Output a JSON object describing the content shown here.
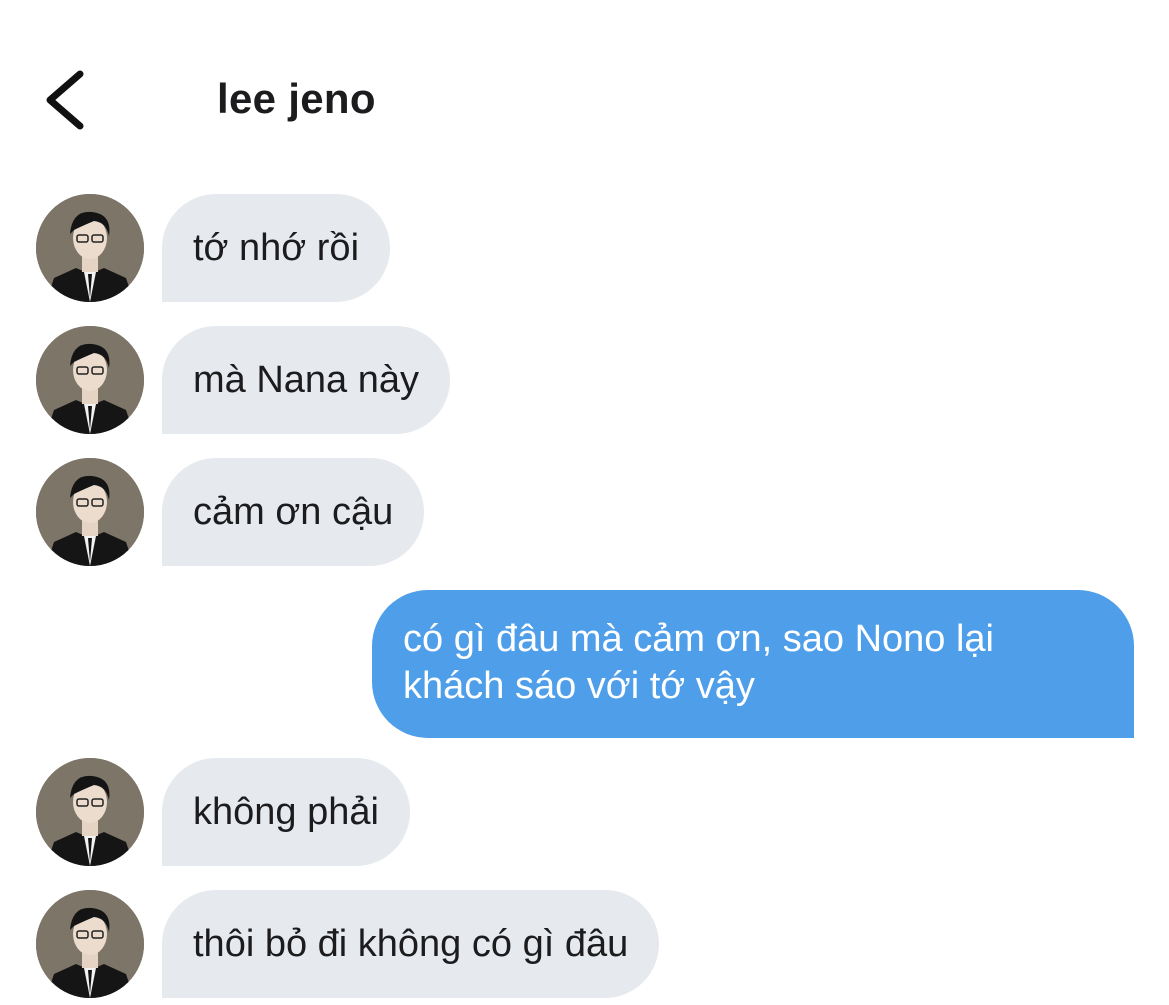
{
  "header": {
    "back_icon": "chevron-left-icon",
    "title": "lee jeno"
  },
  "messages": [
    {
      "sender": "contact",
      "text": "tớ nhớ rồi"
    },
    {
      "sender": "contact",
      "text": "mà Nana này"
    },
    {
      "sender": "contact",
      "text": "cảm ơn cậu"
    },
    {
      "sender": "me",
      "text": "có gì đâu mà cảm ơn, sao Nono lại khách sáo với tớ vậy"
    },
    {
      "sender": "contact",
      "text": "không phải"
    },
    {
      "sender": "contact",
      "text": "thôi bỏ đi không có gì đâu"
    }
  ],
  "colors": {
    "incoming_bubble": "#e6eaee",
    "outgoing_bubble": "#4e9ee9",
    "outgoing_text": "#ffffff",
    "text": "#1c1c1e"
  }
}
